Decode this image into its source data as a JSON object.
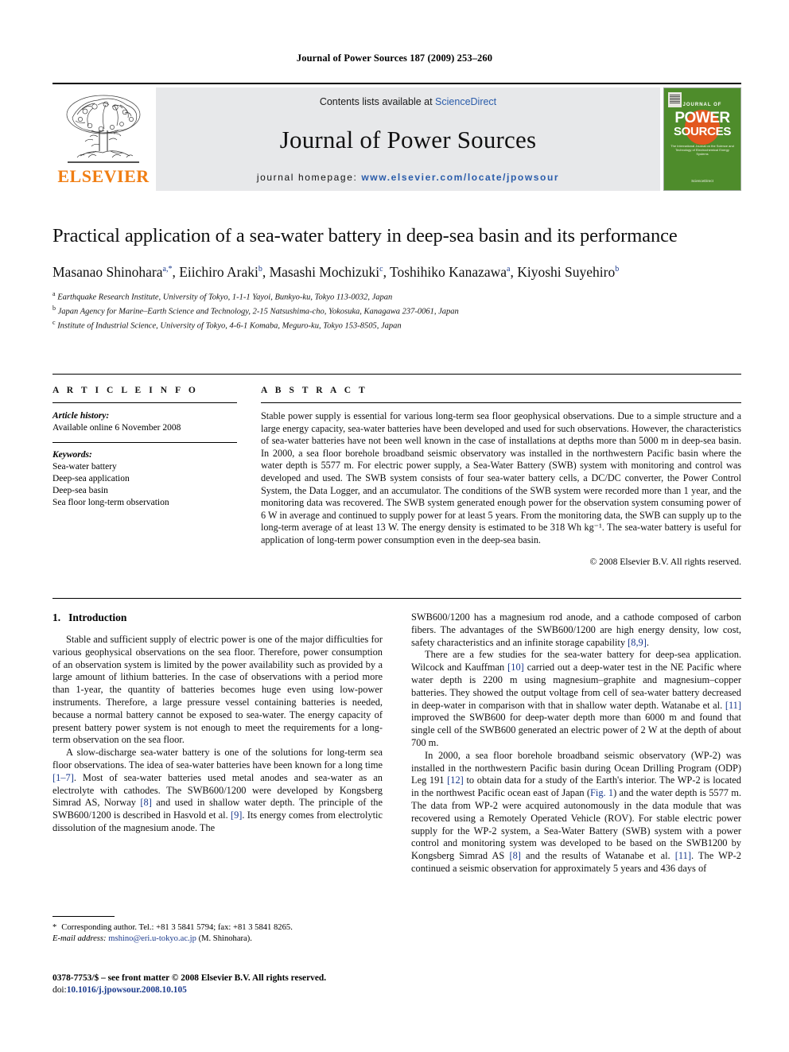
{
  "running_head": "Journal of Power Sources 187 (2009) 253–260",
  "masthead": {
    "publisher_name": "ELSEVIER",
    "contents_prefix": "Contents lists available at ",
    "contents_link": "ScienceDirect",
    "journal_name": "Journal of Power Sources",
    "homepage_prefix": "journal homepage: ",
    "homepage_url": "www.elsevier.com/locate/jpowsour",
    "cover": {
      "journal_of": "JOURNAL OF",
      "power": "POWER",
      "sources": "SOURCES",
      "tagline": "The International Journal on the Science and Technology of Electrochemical Energy Systems",
      "footer": "ScienceDirect",
      "bg_color": "#4e8c2b",
      "circle_color": "#e2571e"
    }
  },
  "article": {
    "title": "Practical application of a sea-water battery in deep-sea basin and its performance",
    "authors": [
      {
        "name": "Masanao Shinohara",
        "marks": "a,*"
      },
      {
        "name": "Eiichiro Araki",
        "marks": "b"
      },
      {
        "name": "Masashi Mochizuki",
        "marks": "c"
      },
      {
        "name": "Toshihiko Kanazawa",
        "marks": "a"
      },
      {
        "name": "Kiyoshi Suyehiro",
        "marks": "b"
      }
    ],
    "affiliations": [
      {
        "mark": "a",
        "text": "Earthquake Research Institute, University of Tokyo, 1-1-1 Yayoi, Bunkyo-ku, Tokyo 113-0032, Japan"
      },
      {
        "mark": "b",
        "text": "Japan Agency for Marine–Earth Science and Technology, 2-15 Natsushima-cho, Yokosuka, Kanagawa 237-0061, Japan"
      },
      {
        "mark": "c",
        "text": "Institute of Industrial Science, University of Tokyo, 4-6-1 Komaba, Meguro-ku, Tokyo 153-8505, Japan"
      }
    ]
  },
  "article_info": {
    "heading": "A R T I C L E   I N F O",
    "history_label": "Article history:",
    "history_value": "Available online 6 November 2008",
    "keywords_label": "Keywords:",
    "keywords": [
      "Sea-water battery",
      "Deep-sea application",
      "Deep-sea basin",
      "Sea floor long-term observation"
    ]
  },
  "abstract": {
    "heading": "A B S T R A C T",
    "body": "Stable power supply is essential for various long-term sea floor geophysical observations. Due to a simple structure and a large energy capacity, sea-water batteries have been developed and used for such observations. However, the characteristics of sea-water batteries have not been well known in the case of installations at depths more than 5000 m in deep-sea basin. In 2000, a sea floor borehole broadband seismic observatory was installed in the northwestern Pacific basin where the water depth is 5577 m. For electric power supply, a Sea-Water Battery (SWB) system with monitoring and control was developed and used. The SWB system consists of four sea-water battery cells, a DC/DC converter, the Power Control System, the Data Logger, and an accumulator. The conditions of the SWB system were recorded more than 1 year, and the monitoring data was recovered. The SWB system generated enough power for the observation system consuming power of 6 W in average and continued to supply power for at least 5 years. From the monitoring data, the SWB can supply up to the long-term average of at least 13 W. The energy density is estimated to be 318 Wh kg⁻¹. The sea-water battery is useful for application of long-term power consumption even in the deep-sea basin.",
    "copyright": "© 2008 Elsevier B.V. All rights reserved."
  },
  "introduction": {
    "heading_number": "1.",
    "heading_title": "Introduction",
    "left_paragraphs": [
      "Stable and sufficient supply of electric power is one of the major difficulties for various geophysical observations on the sea floor. Therefore, power consumption of an observation system is limited by the power availability such as provided by a large amount of lithium batteries. In the case of observations with a period more than 1-year, the quantity of batteries becomes huge even using low-power instruments. Therefore, a large pressure vessel containing batteries is needed, because a normal battery cannot be exposed to sea-water. The energy capacity of present battery power system is not enough to meet the requirements for a long-term observation on the sea floor."
    ],
    "left_paragraph_2_parts": [
      "A slow-discharge sea-water battery is one of the solutions for long-term sea floor observations. The idea of sea-water batteries have been known for a long time ",
      "[1–7]",
      ". Most of sea-water batteries used metal anodes and sea-water as an electrolyte with cathodes. The SWB600/1200 were developed by Kongsberg Simrad AS, Norway ",
      "[8]",
      " and used in shallow water depth. The principle of the SWB600/1200 is described in Hasvold et al. ",
      "[9]",
      ". Its energy comes from electrolytic dissolution of the magnesium anode. The"
    ],
    "right_paragraph_1_parts": [
      "SWB600/1200 has a magnesium rod anode, and a cathode composed of carbon fibers. The advantages of the SWB600/1200 are high energy density, low cost, safety characteristics and an infinite storage capability ",
      "[8,9]",
      "."
    ],
    "right_paragraph_2_parts": [
      "There are a few studies for the sea-water battery for deep-sea application. Wilcock and Kauffman ",
      "[10]",
      " carried out a deep-water test in the NE Pacific where water depth is 2200 m using magnesium–graphite and magnesium–copper batteries. They showed the output voltage from cell of sea-water battery decreased in deep-water in comparison with that in shallow water depth. Watanabe et al. ",
      "[11]",
      " improved the SWB600 for deep-water depth more than 6000 m and found that single cell of the SWB600 generated an electric power of 2 W at the depth of about 700 m."
    ],
    "right_paragraph_3_parts": [
      "In 2000, a sea floor borehole broadband seismic observatory (WP-2) was installed in the northwestern Pacific basin during Ocean Drilling Program (ODP) Leg 191 ",
      "[12]",
      " to obtain data for a study of the Earth's interior. The WP-2 is located in the northwest Pacific ocean east of Japan (",
      "Fig. 1",
      ") and the water depth is 5577 m. The data from WP-2 were acquired autonomously in the data module that was recovered using a Remotely Operated Vehicle (ROV). For stable electric power supply for the WP-2 system, a Sea-Water Battery (SWB) system with a power control and monitoring system was developed to be based on the SWB1200 by Kongsberg Simrad AS ",
      "[8]",
      " and the results of Watanabe et al. ",
      "[11]",
      ". The WP-2 continued a seismic observation for approximately 5 years and 436 days of"
    ]
  },
  "footnotes": {
    "star": "*",
    "corresponding": "Corresponding author. Tel.: +81 3 5841 5794; fax: +81 3 5841 8265.",
    "email_label": "E-mail address:",
    "email": "mshino@eri.u-tokyo.ac.jp",
    "email_suffix": "(M. Shinohara)."
  },
  "imprint": {
    "issn_line": "0378-7753/$ – see front matter © 2008 Elsevier B.V. All rights reserved.",
    "doi_label": "doi:",
    "doi_value": "10.1016/j.jpowsour.2008.10.105"
  }
}
